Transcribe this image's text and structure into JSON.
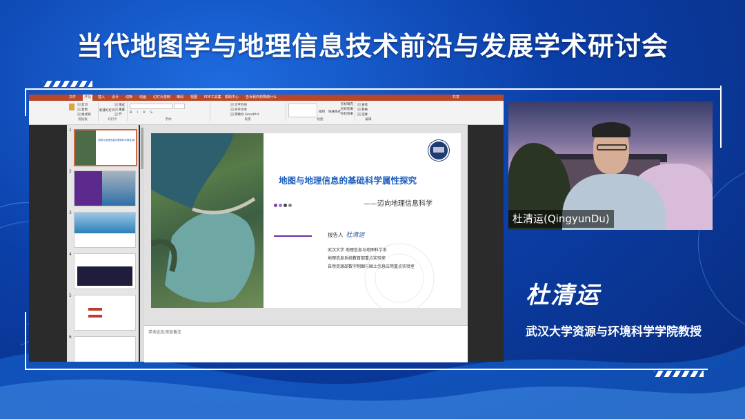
{
  "banner": {
    "title": "当代地图学与地理信息技术前沿与发展学术研讨会"
  },
  "app": {
    "tabs": [
      "文件",
      "开始",
      "插入",
      "设计",
      "切换",
      "动画",
      "幻灯片放映",
      "审阅",
      "视图",
      "PDF工具集",
      "帮助中心",
      "告诉我你想要做什么"
    ],
    "active_tab": "开始",
    "share_label": "共享",
    "ribbon": {
      "groups": [
        "剪贴板",
        "幻灯片",
        "字体",
        "段落",
        "绘图",
        "编辑"
      ],
      "buttons": {
        "paste": "粘贴",
        "cut": "剪切",
        "copy": "复制",
        "format_painter": "格式刷",
        "new_slide": "新建幻灯片",
        "layout": "版式",
        "reset": "重置",
        "section": "节",
        "text_direction": "文字方向",
        "align_text": "对齐文本",
        "smartart": "转换为 SmartArt",
        "arrange": "排列",
        "quick_styles": "快速样式",
        "shape_fill": "形状填充",
        "shape_outline": "形状轮廓",
        "shape_effects": "形状效果",
        "find": "查找",
        "replace": "替换",
        "select": "选择"
      }
    },
    "thumbnails": [
      {
        "num": "1",
        "caption": "地图与地理信息的基础科学属性探究"
      },
      {
        "num": "2",
        "caption": ""
      },
      {
        "num": "3",
        "caption": ""
      },
      {
        "num": "4",
        "caption": ""
      },
      {
        "num": "5",
        "caption": ""
      },
      {
        "num": "6",
        "caption": ""
      }
    ],
    "slide": {
      "title": "地图与地理信息的基础科学属性探究",
      "subtitle": "——迈向地理信息科学",
      "reporter_label": "报告人",
      "reporter_signature": "杜清运",
      "affiliations": [
        "武汉大学 地理信息与地图科学系",
        "地理信息系统教育部重点实验室",
        "自然资源部数字制图与国土信息应用重点实验室"
      ],
      "dot_colors": [
        "#7b3fb0",
        "#a070cc",
        "#444444",
        "#888888"
      ]
    },
    "notes_placeholder": "单击此处添加备注"
  },
  "speaker": {
    "video_name": "杜清运(QingyunDu)",
    "signature_name": "杜清运",
    "affiliation": "武汉大学资源与环境科学学院教授"
  },
  "colors": {
    "accent_ppt": "#b7472a",
    "slide_title": "#1f5fbf",
    "background": "#0b3fa8"
  }
}
